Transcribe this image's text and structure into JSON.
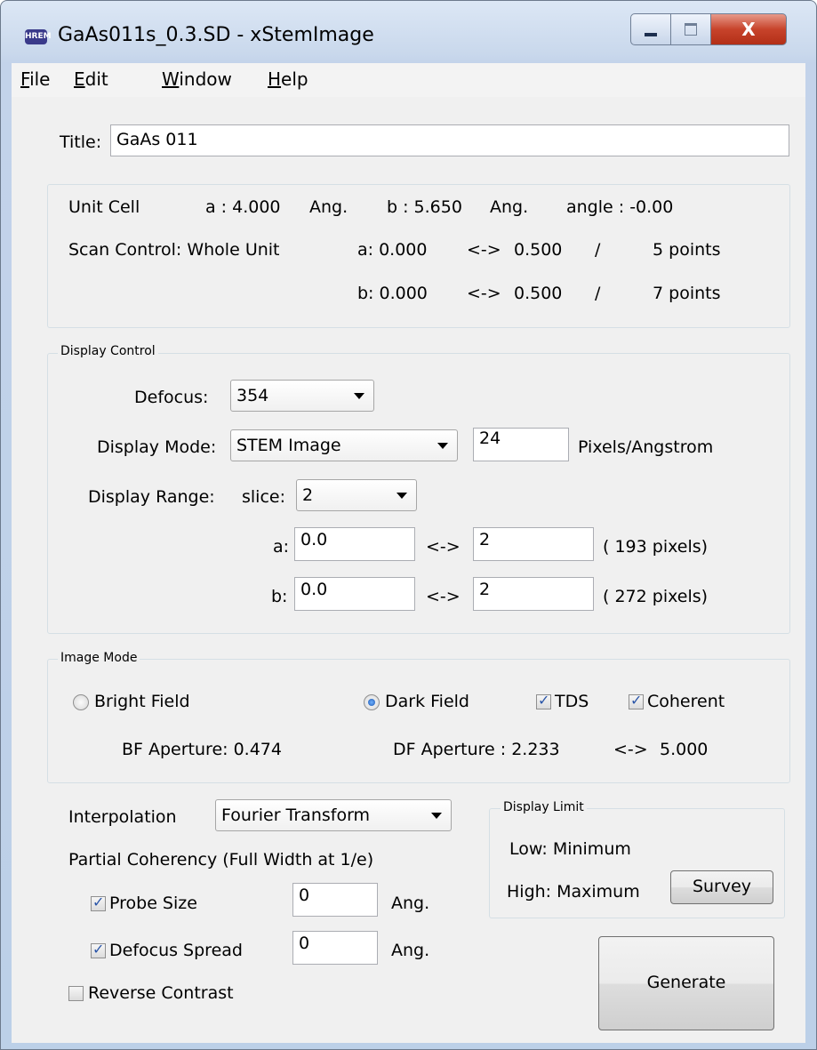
{
  "window": {
    "icon_text": "HREM",
    "title": "GaAs011s_0.3.SD - xStemImage",
    "close_glyph": "X"
  },
  "menu": [
    "File",
    "Edit",
    "Window",
    "Help"
  ],
  "title_field": {
    "label": "Title:",
    "value": "GaAs 011"
  },
  "unit_cell": {
    "label": "Unit Cell",
    "a": "a : 4.000",
    "a_unit": "Ang.",
    "b": "b : 5.650",
    "b_unit": "Ang.",
    "angle": "angle : -0.00"
  },
  "scan_control": {
    "label": "Scan Control: Whole Unit",
    "rows": [
      {
        "axis": "a: 0.000",
        "arrow": "<->",
        "end": "0.500",
        "slash": "/",
        "points": "5 points"
      },
      {
        "axis": "b: 0.000",
        "arrow": "<->",
        "end": "0.500",
        "slash": "/",
        "points": "7 points"
      }
    ]
  },
  "display_control": {
    "group_label": "Display Control",
    "defocus_label": "Defocus:",
    "defocus_value": "354",
    "mode_label": "Display Mode:",
    "mode_value": "STEM Image",
    "pixels_value": "24",
    "pixels_unit": "Pixels/Angstrom",
    "range_label": "Display Range:",
    "slice_label": "slice:",
    "slice_value": "2",
    "a_label": "a:",
    "a_from": "0.0",
    "a_arrow": "<->",
    "a_to": "2",
    "a_pixels": "( 193 pixels)",
    "b_label": "b:",
    "b_from": "0.0",
    "b_arrow": "<->",
    "b_to": "2",
    "b_pixels": "( 272 pixels)"
  },
  "image_mode": {
    "group_label": "Image Mode",
    "bright_field": "Bright Field",
    "dark_field": "Dark Field",
    "tds": "TDS",
    "coherent": "Coherent",
    "selected": "dark_field",
    "tds_checked": true,
    "coherent_checked": true,
    "bf_aperture": "BF Aperture: 0.474",
    "df_aperture": "DF Aperture : 2.233",
    "df_arrow": "<->",
    "df_end": "5.000"
  },
  "interpolation": {
    "label": "Interpolation",
    "value": "Fourier Transform"
  },
  "partial_coherency": {
    "label": "Partial Coherency (Full Width at 1/e)",
    "probe_size_label": "Probe Size",
    "probe_size_value": "0",
    "probe_size_checked": true,
    "defocus_spread_label": "Defocus Spread",
    "defocus_spread_value": "0",
    "defocus_spread_checked": true,
    "unit": "Ang."
  },
  "reverse_contrast": {
    "label": "Reverse Contrast",
    "checked": false
  },
  "display_limit": {
    "group_label": "Display Limit",
    "low": "Low:  Minimum",
    "high": "High:  Maximum",
    "survey_button": "Survey"
  },
  "generate_button": "Generate"
}
